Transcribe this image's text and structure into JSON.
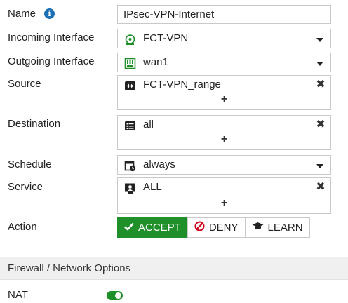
{
  "form": {
    "name_label": "Name",
    "name_value": "IPsec-VPN-Internet",
    "incoming_label": "Incoming Interface",
    "incoming_value": "FCT-VPN",
    "outgoing_label": "Outgoing Interface",
    "outgoing_value": "wan1",
    "source_label": "Source",
    "source_value": "FCT-VPN_range",
    "destination_label": "Destination",
    "destination_value": "all",
    "schedule_label": "Schedule",
    "schedule_value": "always",
    "service_label": "Service",
    "service_value": "ALL",
    "add_symbol": "+",
    "remove_symbol": "✖",
    "action_label": "Action",
    "actions": [
      {
        "label": "ACCEPT",
        "icon": "check-icon",
        "selected": true
      },
      {
        "label": "DENY",
        "icon": "deny-icon",
        "selected": false
      },
      {
        "label": "LEARN",
        "icon": "learn-icon",
        "selected": false
      }
    ]
  },
  "section": {
    "title": "Firewall / Network Options"
  },
  "nat": {
    "label": "NAT",
    "enabled": true
  },
  "colors": {
    "accent": "#1e8f29",
    "info": "#1a6fb5",
    "deny": "#d0021b"
  }
}
